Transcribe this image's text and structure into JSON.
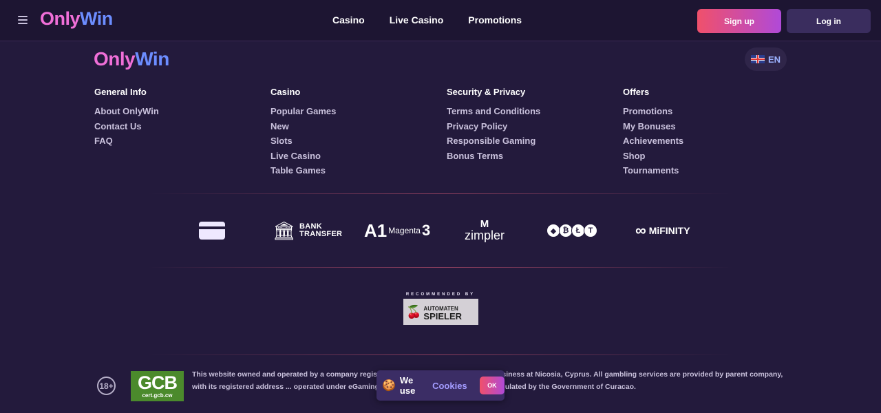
{
  "header": {
    "menu_icon": "hamburger-icon",
    "logo": {
      "part1": "Only",
      "part2": "Win"
    },
    "nav": [
      "Casino",
      "Live Casino",
      "Promotions"
    ],
    "signup_label": "Sign up",
    "login_label": "Log in"
  },
  "footer": {
    "logo": {
      "part1": "Only",
      "part2": "Win"
    },
    "language": {
      "flag_icon": "uk-flag-icon",
      "code": "EN"
    },
    "columns": [
      {
        "title": "General Info",
        "links": [
          "About OnlyWin",
          "Contact Us",
          "FAQ"
        ]
      },
      {
        "title": "Casino",
        "links": [
          "Popular Games",
          "New",
          "Slots",
          "Live Casino",
          "Table Games"
        ]
      },
      {
        "title": "Security & Privacy",
        "links": [
          "Terms and Conditions",
          "Privacy Policy",
          "Responsible Gaming",
          "Bonus Terms"
        ]
      },
      {
        "title": "Offers",
        "links": [
          "Promotions",
          "My Bonuses",
          "Achievements",
          "Shop",
          "Tournaments"
        ]
      }
    ],
    "payments": {
      "card_icon": "credit-card-icon",
      "bank": {
        "line1": "BANK",
        "line2": "TRANSFER"
      },
      "magenta": {
        "a1": "A1",
        "name": "Magenta",
        "three": "3"
      },
      "zimpler": {
        "mark": "M",
        "name": "zimpler"
      },
      "crypto": [
        "◆",
        "₿",
        "Ł",
        "T"
      ],
      "mifinity": {
        "symbol": "∞",
        "name": "MiFINITY"
      }
    },
    "recommended": {
      "label": "RECOMMENDED BY",
      "line1": "AUTOMATEN",
      "line2": "SPIELER"
    },
    "age_badge": "18+",
    "gcb": {
      "main": "GCB",
      "sub": "cert.gcb.cw"
    },
    "legal_text": "This website owned and operated by a company registered ... with its principal place of business at Nicosia, Cyprus. All gambling services are provided by parent company, with its registered address ... operated under eGaming License, issued Authorized and Regulated by the Government of Curacao."
  },
  "cookie_banner": {
    "icon": "cookie-icon",
    "text": "We use",
    "link": "Cookies",
    "ok_label": "OK"
  },
  "colors": {
    "background": "#231a3c",
    "navbar": "#1d1532",
    "accent_pink": "#f0506b",
    "accent_purple": "#b04ad8",
    "link_blue": "#a39cff"
  }
}
